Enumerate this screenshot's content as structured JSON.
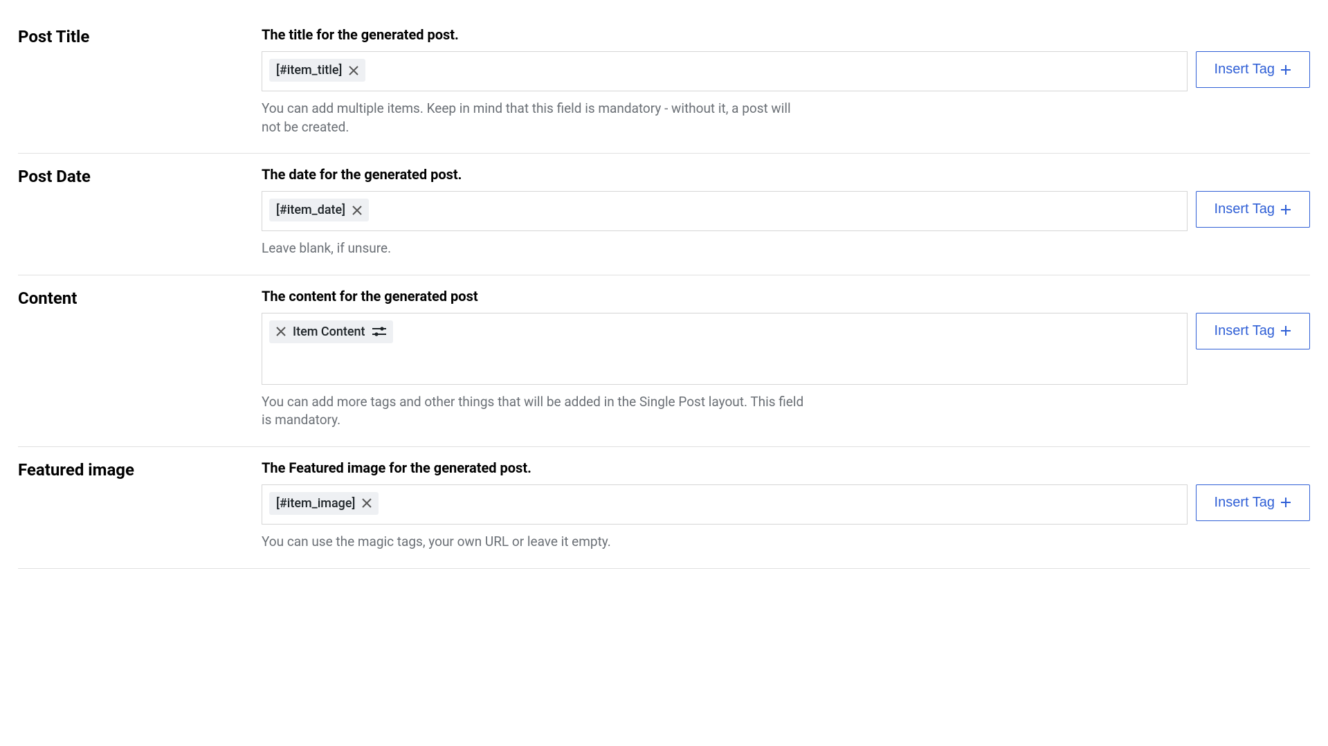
{
  "insertTagLabel": "Insert Tag",
  "sections": {
    "postTitle": {
      "label": "Post Title",
      "desc": "The title for the generated post.",
      "tag": "[#item_title]",
      "help": "You can add multiple items. Keep in mind that this field is mandatory - without it, a post will not be created."
    },
    "postDate": {
      "label": "Post Date",
      "desc": "The date for the generated post.",
      "tag": "[#item_date]",
      "help": "Leave blank, if unsure."
    },
    "content": {
      "label": "Content",
      "desc": "The content for the generated post",
      "tag": "Item Content",
      "help": "You can add more tags and other things that will be added in the Single Post layout. This field is mandatory."
    },
    "featuredImage": {
      "label": "Featured image",
      "desc": "The Featured image for the generated post.",
      "tag": "[#item_image]",
      "help": "You can use the magic tags, your own URL or leave it empty."
    }
  }
}
